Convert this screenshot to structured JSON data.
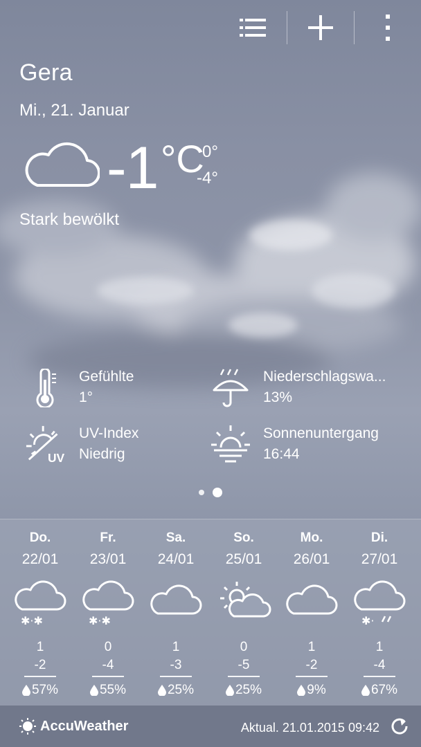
{
  "location": {
    "city": "Gera",
    "date": "Mi., 21. Januar"
  },
  "current": {
    "temp": "-1",
    "unit": "°C",
    "high": "0°",
    "low": "-4°",
    "condition": "Stark bewölkt",
    "icon": "cloud-icon"
  },
  "details": [
    {
      "label": "Gefühlte",
      "value": "1°",
      "icon": "thermometer-icon"
    },
    {
      "label": "Niederschlagswa...",
      "value": "13%",
      "icon": "umbrella-rain-icon"
    },
    {
      "label": "UV-Index",
      "value": "Niedrig",
      "icon": "uv-index-icon"
    },
    {
      "label": "Sonnenuntergang",
      "value": "16:44",
      "icon": "sunset-icon"
    }
  ],
  "pager": {
    "page_count": 2,
    "active_index": 1
  },
  "forecast": [
    {
      "day": "Do.",
      "date": "22/01",
      "high": "1",
      "low": "-2",
      "precip": "57%",
      "icon": "cloud-snow-icon"
    },
    {
      "day": "Fr.",
      "date": "23/01",
      "high": "0",
      "low": "-4",
      "precip": "55%",
      "icon": "cloud-snow-icon"
    },
    {
      "day": "Sa.",
      "date": "24/01",
      "high": "1",
      "low": "-3",
      "precip": "25%",
      "icon": "cloud-icon"
    },
    {
      "day": "So.",
      "date": "25/01",
      "high": "0",
      "low": "-5",
      "precip": "25%",
      "icon": "sun-cloud-icon"
    },
    {
      "day": "Mo.",
      "date": "26/01",
      "high": "1",
      "low": "-2",
      "precip": " 9%",
      "icon": "cloud-icon"
    },
    {
      "day": "Di.",
      "date": "27/01",
      "high": "1",
      "low": "-4",
      "precip": "67%",
      "icon": "cloud-sleet-icon"
    }
  ],
  "footer": {
    "brand": "AccuWeather",
    "updated": "Aktual. 21.01.2015 09:42"
  },
  "colors": {
    "text": "#ffffff",
    "panel": "#a0a8b8",
    "footer": "#6e7688"
  }
}
